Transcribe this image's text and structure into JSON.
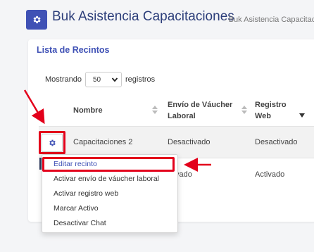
{
  "header": {
    "title": "Buk Asistencia Capacitaciones",
    "subtitle": "- Buk Asistencia Capacitac",
    "icon": "gear-icon"
  },
  "card": {
    "title": "Lista de Recintos",
    "show_prefix": "Mostrando",
    "page_size": "50",
    "show_suffix": "registros"
  },
  "table": {
    "columns": [
      {
        "label": "Nombre"
      },
      {
        "label_line1": "Envío de Váucher",
        "label_line2": "Laboral"
      },
      {
        "label_line1": "Registro",
        "label_line2": "Web"
      }
    ],
    "rows": [
      {
        "name": "Capacitaciones 2",
        "envio": "Desactivado",
        "registro": "Desactivado"
      },
      {
        "name": "",
        "envio": "ctivado",
        "registro": "Activado"
      }
    ]
  },
  "menu": {
    "items": [
      "Editar recinto",
      "Activar envío de váucher laboral",
      "Activar registro web",
      "Marcar Activo",
      "Desactivar Chat"
    ]
  },
  "colors": {
    "accent": "#3f51b5",
    "highlight": "#e3001b"
  }
}
